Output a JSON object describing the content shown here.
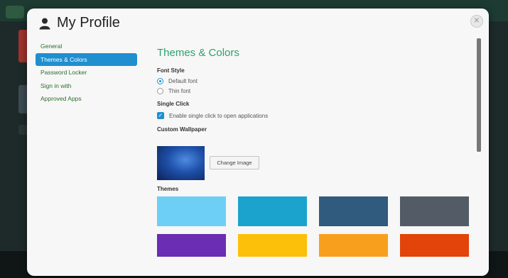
{
  "window": {
    "title": "My Profile"
  },
  "sidebar": {
    "items": [
      {
        "label": "General",
        "active": false
      },
      {
        "label": "Themes & Colors",
        "active": true
      },
      {
        "label": "Password Locker",
        "active": false
      },
      {
        "label": "Sign in with",
        "active": false
      },
      {
        "label": "Approved Apps",
        "active": false
      }
    ]
  },
  "main": {
    "heading": "Themes & Colors",
    "font_style": {
      "label": "Font Style",
      "options": [
        {
          "label": "Default font",
          "selected": true
        },
        {
          "label": "Thin font",
          "selected": false
        }
      ]
    },
    "single_click": {
      "label": "Single Click",
      "checkbox_label": "Enable single click to open applications",
      "checked": true
    },
    "wallpaper": {
      "label": "Custom Wallpaper",
      "button_label": "Change Image"
    },
    "themes": {
      "label": "Themes",
      "colors": [
        "#6dcff6",
        "#1ba3ce",
        "#305a7e",
        "#535c66",
        "#6a2db3",
        "#fcc00b",
        "#f8a01d",
        "#e2440a"
      ]
    }
  },
  "icons": {
    "user": "user-icon",
    "close": "close-icon",
    "check": "check-icon"
  },
  "accent_color": "#1f8fd0"
}
